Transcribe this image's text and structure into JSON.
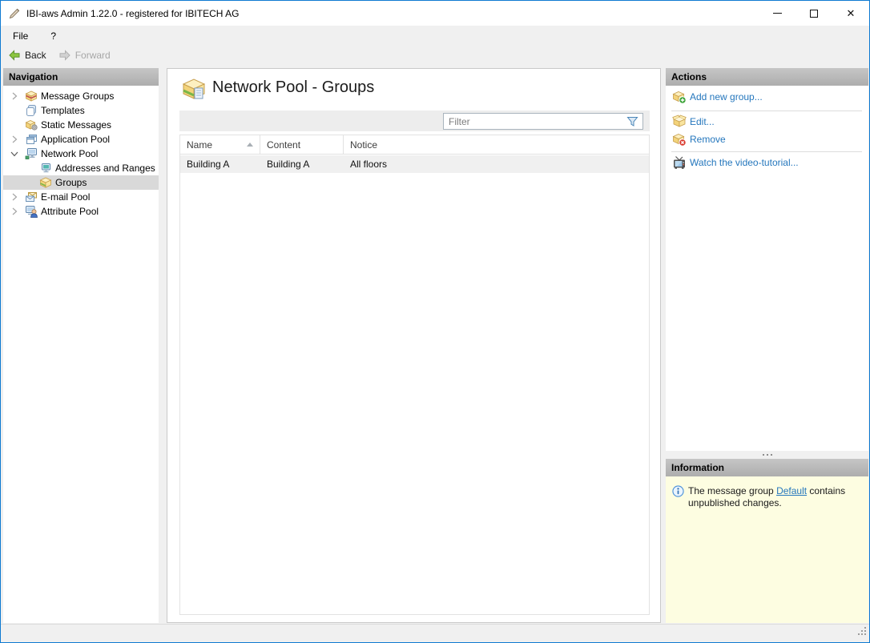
{
  "window": {
    "title": "IBI-aws Admin 1.22.0 - registered for IBITECH AG",
    "accent_border_color": "#0f7ad1"
  },
  "menu": {
    "file": "File",
    "help": "?"
  },
  "toolbar": {
    "back": "Back",
    "forward": "Forward",
    "back_enabled": true,
    "forward_enabled": false
  },
  "navigation": {
    "header": "Navigation",
    "items": [
      {
        "label": "Message Groups",
        "icon": "message-groups-icon",
        "expander": "collapsed",
        "level": 0,
        "selected": false
      },
      {
        "label": "Templates",
        "icon": "templates-icon",
        "expander": "none",
        "level": 0,
        "selected": false
      },
      {
        "label": "Static Messages",
        "icon": "static-messages-icon",
        "expander": "none",
        "level": 0,
        "selected": false
      },
      {
        "label": "Application Pool",
        "icon": "application-pool-icon",
        "expander": "collapsed",
        "level": 0,
        "selected": false
      },
      {
        "label": "Network Pool",
        "icon": "network-pool-icon",
        "expander": "expanded",
        "level": 0,
        "selected": false
      },
      {
        "label": "Addresses and Ranges",
        "icon": "addresses-icon",
        "expander": "none",
        "level": 1,
        "selected": false
      },
      {
        "label": "Groups",
        "icon": "groups-icon",
        "expander": "none",
        "level": 1,
        "selected": true
      },
      {
        "label": "E-mail Pool",
        "icon": "email-pool-icon",
        "expander": "collapsed",
        "level": 0,
        "selected": false
      },
      {
        "label": "Attribute Pool",
        "icon": "attribute-pool-icon",
        "expander": "collapsed",
        "level": 0,
        "selected": false
      }
    ]
  },
  "main": {
    "title": "Network Pool - Groups",
    "title_icon": "group-box-icon",
    "filter_placeholder": "Filter",
    "table": {
      "columns": [
        "Name",
        "Content",
        "Notice"
      ],
      "sorted_column": "Name",
      "sort_direction": "ascending",
      "rows": [
        {
          "name": "Building A",
          "content": "Building A",
          "notice": "All floors"
        }
      ]
    }
  },
  "actions": {
    "header": "Actions",
    "items": [
      {
        "label": "Add new group...",
        "icon": "add-group-icon"
      },
      {
        "label": "Edit...",
        "icon": "edit-group-icon"
      },
      {
        "label": "Remove",
        "icon": "remove-group-icon"
      },
      {
        "label": "Watch the video-tutorial...",
        "icon": "tv-icon"
      }
    ]
  },
  "information": {
    "header": "Information",
    "text_before": "The message group ",
    "link": "Default",
    "text_after": " contains unpublished changes.",
    "background_color": "#fdfde1",
    "link_color": "#2577bd"
  },
  "icons": {
    "window": [
      "minimize-icon",
      "maximize-icon",
      "close-icon"
    ],
    "toolbar": [
      "back-arrow-icon",
      "forward-arrow-icon"
    ],
    "filter": "funnel-icon",
    "info": "info-circle-icon",
    "grip": "resize-grip-icon"
  }
}
